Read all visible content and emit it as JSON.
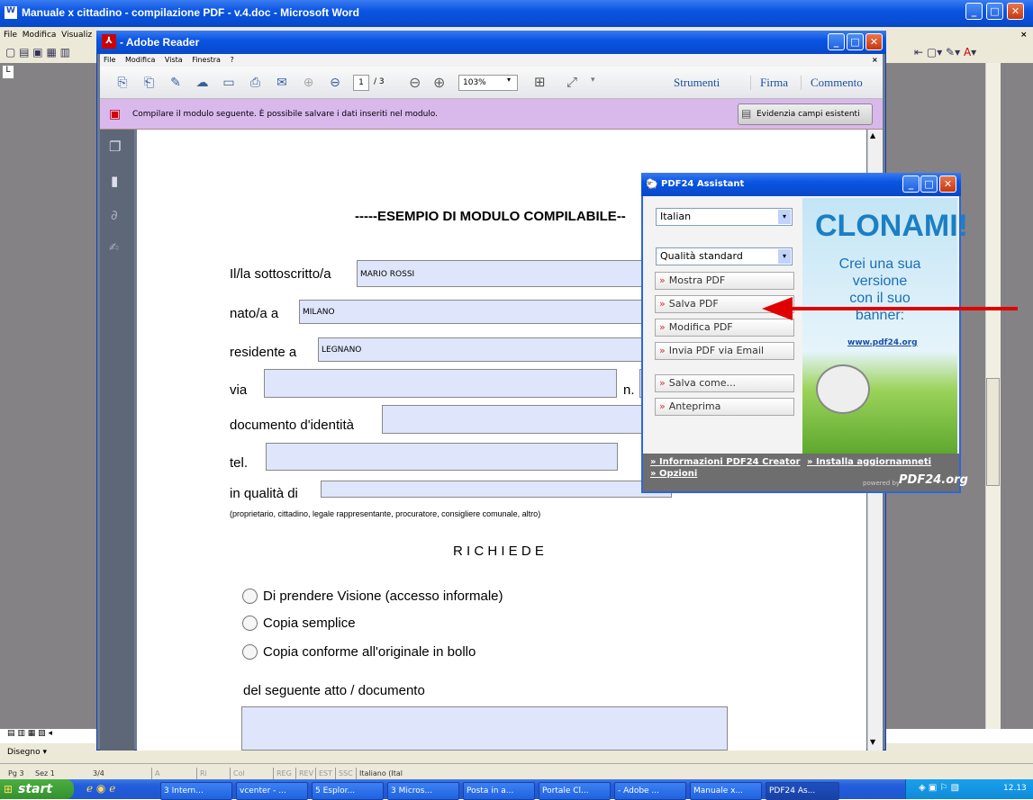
{
  "word": {
    "title": "Manuale x cittadino - compilazione PDF - v.4.doc - Microsoft Word",
    "menu": [
      "File",
      "Modifica",
      "Visualiz"
    ],
    "draw_label": "Disegno ▾",
    "status": [
      "Pg 3",
      "Sez 1",
      "3/4",
      "A",
      "Ri",
      "Col",
      "REG",
      "REV",
      "EST",
      "SSC",
      "Italiano (Ital"
    ]
  },
  "reader": {
    "title": " - Adobe Reader",
    "menu": [
      "File",
      "Modifica",
      "Vista",
      "Finestra",
      "?"
    ],
    "page_current": "1",
    "page_total": "/ 3",
    "zoom": "103%",
    "tool_links": [
      "Strumenti",
      "Firma",
      "Commento"
    ],
    "notice": "Compilare il modulo seguente. È possibile salvare i dati inseriti nel modulo.",
    "highlight_button": "Evidenzia campi esistenti"
  },
  "form": {
    "heading": "-----ESEMPIO DI MODULO COMPILABILE--",
    "lbl_sott": "Il/la sottoscritto/a",
    "val_sott": "MARIO ROSSI",
    "lbl_nato": "nato/a a",
    "val_nato": "MILANO",
    "lbl_res": "residente a",
    "val_res": "LEGNANO",
    "lbl_via": "via",
    "lbl_n": "n.",
    "lbl_doc": "documento d'identità",
    "lbl_tel": "tel.",
    "lbl_qual": "in qualità di",
    "hint": "(proprietario, cittadino, legale rappresentante, procuratore, consigliere comunale, altro)",
    "richiede": "R I C H I E D E",
    "options": [
      "Di prendere Visione (accesso informale)",
      "Copia semplice",
      "Copia conforme all'originale in bollo"
    ],
    "atto": "del seguente atto / documento"
  },
  "assistant": {
    "title": "PDF24 Assistant",
    "language": "Italian",
    "quality": "Qualità standard",
    "buttons": [
      "Mostra PDF",
      "Salva PDF",
      "Modifica PDF",
      "Invia PDF via Email",
      "Salva come...",
      "Anteprima"
    ],
    "banner_title": "CLONAMI!",
    "banner_text": [
      "Crei una sua",
      "versione",
      "con il suo",
      "banner:"
    ],
    "banner_link": "www.pdf24.org",
    "link_info": "Informazioni PDF24 Creator",
    "link_update": "Installa aggiornamneti",
    "link_options": "Opzioni",
    "powered": "powered by",
    "brand": "PDF24.org"
  },
  "taskbar": {
    "start": "start",
    "items": [
      "3 Intern...",
      "vcenter - ...",
      "5 Esplor...",
      "3 Micros...",
      "Posta in a...",
      "Portale Cl...",
      "- Adobe ...",
      "Manuale x...",
      "PDF24 As..."
    ],
    "clock": "12.13"
  }
}
